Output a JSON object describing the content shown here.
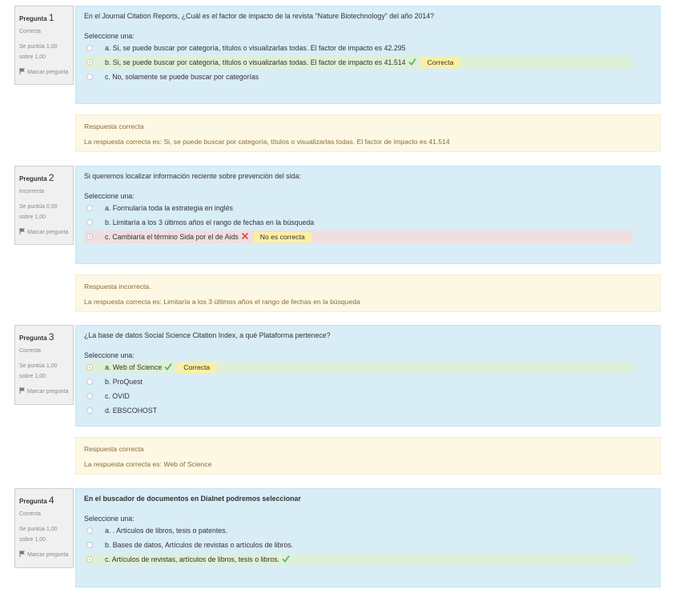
{
  "labels": {
    "question_word": "Pregunta",
    "flag": "Marcar pregunta",
    "prompt": "Seleccione una:"
  },
  "colors": {
    "correct_check": "#5cb85c",
    "incorrect_cross": "#d9534f",
    "badge_bg": "#fcefa1"
  },
  "questions": [
    {
      "number": "1",
      "state": "Correcta",
      "grade": "Se puntúa 1,00 sobre 1,00",
      "text": "En el Journal Citation Reports, ¿Cuál es el factor de impacto de la revista \"Nature Biotechnology\" del año 2014?",
      "options": [
        {
          "label": "a. Si, se puede buscar por categoría, títulos o visualizarlas todas. El factor de impacto es 42.295"
        },
        {
          "label": "b. Si, se puede buscar por categoría, títulos o visualizarlas todas. El factor de impacto es 41.514",
          "selected": true,
          "mark": "check-icon",
          "badge": "Correcta"
        },
        {
          "label": "c. No, solamente se puede buscar por categorías"
        }
      ],
      "feedback_title": "Respuesta correcta",
      "feedback_text": "La respuesta correcta es: Si, se puede buscar por categoría, títulos o visualizarlas todas. El factor de impacto es 41.514"
    },
    {
      "number": "2",
      "state": "Incorrecta",
      "grade": "Se puntúa 0,00 sobre 1,00",
      "text": "Si queremos localizar información reciente sobre prevención del sida:",
      "options": [
        {
          "label": "a. Formularía toda la estrategia en inglés"
        },
        {
          "label": "b. Limitaría a los 3 últimos años el rango de fechas en la búsqueda"
        },
        {
          "label": "c. Cambiaría el término Sida por el de Aids",
          "selected": true,
          "mark": "cross-icon",
          "badge": "No es correcta"
        }
      ],
      "feedback_title": "Respuesta incorrecta.",
      "feedback_text": "La respuesta correcta es: Limitaría a los 3 últimos años el rango de fechas en la búsqueda"
    },
    {
      "number": "3",
      "state": "Correcta",
      "grade": "Se puntúa 1,00 sobre 1,00",
      "text": "¿La base de datos Social Science Citation Index, a qué Plataforma pertenece?",
      "options": [
        {
          "label": "a. Web of Science",
          "selected": true,
          "mark": "check-icon",
          "badge": "Correcta"
        },
        {
          "label": "b. ProQuest"
        },
        {
          "label": "c. OVID"
        },
        {
          "label": "d. EBSCOHOST"
        }
      ],
      "feedback_title": "Respuesta correcta",
      "feedback_text": "La respuesta correcta es: Web of Science"
    },
    {
      "number": "4",
      "state": "Correcta",
      "grade": "Se puntúa 1,00 sobre 1,00",
      "text": "En el buscador de documentos en Dialnet podremos seleccionar",
      "text_bold": true,
      "options": [
        {
          "label": "a. . Artículos de libros, tesis o patentes."
        },
        {
          "label": "b. Bases de datos, Artículos de revistas o artículos de libros."
        },
        {
          "label": "c. Artículos de revistas, artículos de libros, tesis o libros.",
          "selected": true,
          "mark": "check-icon"
        }
      ]
    }
  ]
}
